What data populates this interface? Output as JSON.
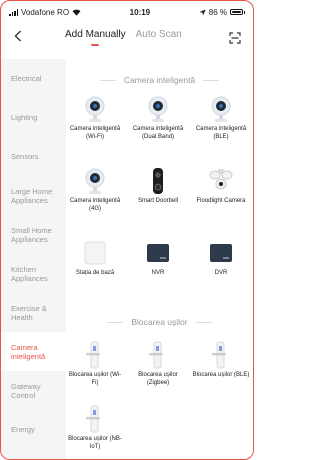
{
  "status_bar": {
    "carrier": "Vodafone RO",
    "time": "10:19",
    "battery": "86 %",
    "battery_level": 0.86
  },
  "header": {
    "back_icon": "chevron-left-icon",
    "tab_manual": "Add Manually",
    "tab_scan": "Auto Scan",
    "scan_icon": "scan-frame-icon"
  },
  "sidebar": {
    "items": [
      {
        "label": "Electrical",
        "active": false
      },
      {
        "label": "Lighting",
        "active": false
      },
      {
        "label": "Sensors",
        "active": false
      },
      {
        "label": "Large Home Appliances",
        "active": false
      },
      {
        "label": "Small Home Appliances",
        "active": false
      },
      {
        "label": "Kitchen Appliances",
        "active": false
      },
      {
        "label": "Exercise & Health",
        "active": false
      },
      {
        "label": "Camera inteligentă",
        "active": true
      },
      {
        "label": "Gateway Control",
        "active": false
      },
      {
        "label": "Energy",
        "active": false
      }
    ]
  },
  "sections": [
    {
      "title": "Camera inteligentă",
      "devices": [
        {
          "label": "Camera inteligentă (Wi-Fi)",
          "icon": "camera-icon"
        },
        {
          "label": "Camera inteligentă (Dual Band)",
          "icon": "camera-icon"
        },
        {
          "label": "Camera inteligentă (BLE)",
          "icon": "camera-icon"
        },
        {
          "label": "Camera inteligentă (4G)",
          "icon": "camera-icon"
        },
        {
          "label": "Smart Doorbell",
          "icon": "doorbell-icon"
        },
        {
          "label": "Floodlight Camera",
          "icon": "floodlight-camera-icon"
        },
        {
          "label": "Stația de bază",
          "icon": "base-station-icon"
        },
        {
          "label": "NVR",
          "icon": "nvr-icon"
        },
        {
          "label": "DVR",
          "icon": "dvr-icon"
        }
      ]
    },
    {
      "title": "Blocarea ușilor",
      "devices": [
        {
          "label": "Blocarea ușilor (Wi-Fi)",
          "icon": "door-lock-icon"
        },
        {
          "label": "Blocarea ușilor (Zigbee)",
          "icon": "door-lock-icon"
        },
        {
          "label": "Blocarea ușilor (BLE)",
          "icon": "door-lock-icon"
        },
        {
          "label": "Blocarea ușilor (NB-IoT)",
          "icon": "door-lock-icon"
        }
      ]
    }
  ],
  "colors": {
    "accent": "#e8544a",
    "sidebar_bg": "#f5f5f5",
    "muted_text": "#999999"
  }
}
